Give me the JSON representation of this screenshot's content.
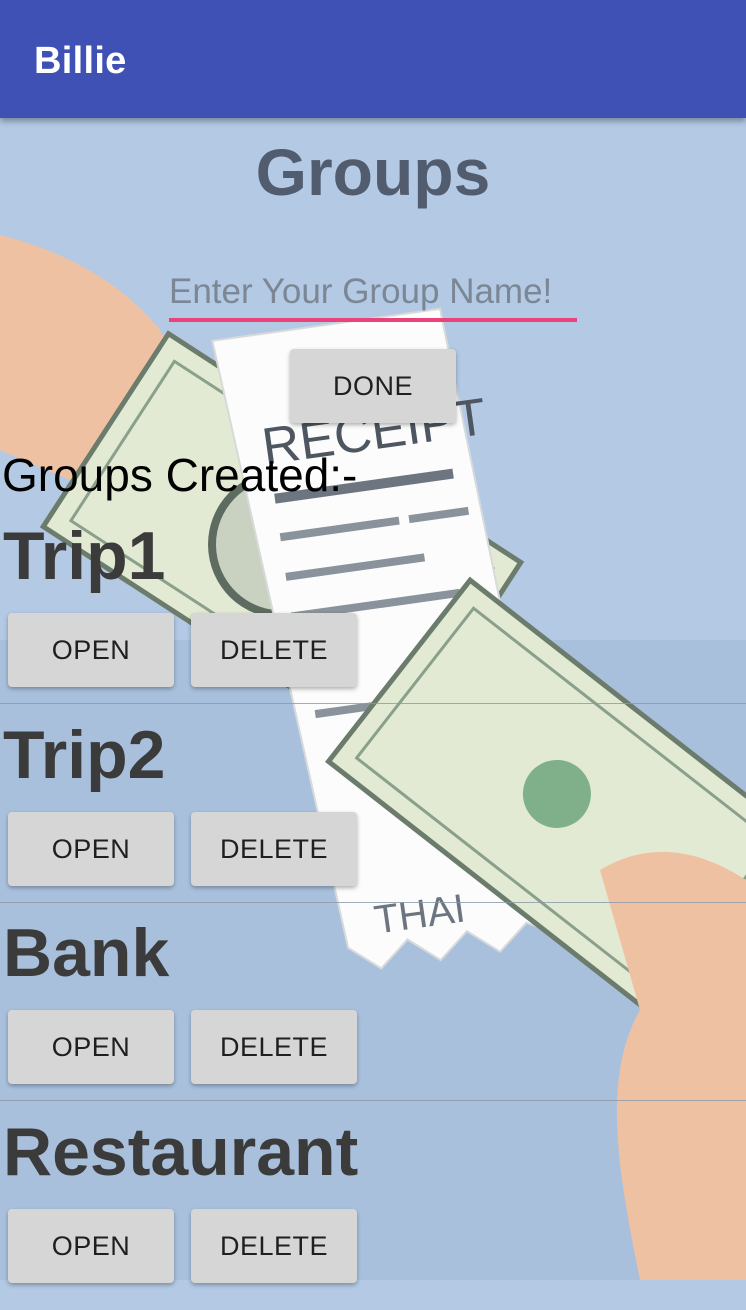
{
  "app": {
    "title": "Billie"
  },
  "page": {
    "title": "Groups"
  },
  "form": {
    "placeholder": "Enter Your Group Name!",
    "value": "",
    "done_label": "DONE"
  },
  "groups_section": {
    "label": "Groups Created:-",
    "items": [
      {
        "name": "Trip1",
        "open_label": "OPEN",
        "delete_label": "DELETE"
      },
      {
        "name": "Trip2",
        "open_label": "OPEN",
        "delete_label": "DELETE"
      },
      {
        "name": "Bank",
        "open_label": "OPEN",
        "delete_label": "DELETE"
      },
      {
        "name": "Restaurant",
        "open_label": "OPEN",
        "delete_label": "DELETE"
      }
    ]
  },
  "background": {
    "receipt_text": "RECEIPT",
    "receipt_footer": "THAI"
  },
  "colors": {
    "appbar": "#3f51b5",
    "input_underline": "#e9437a",
    "background": "#b3c9e4"
  }
}
